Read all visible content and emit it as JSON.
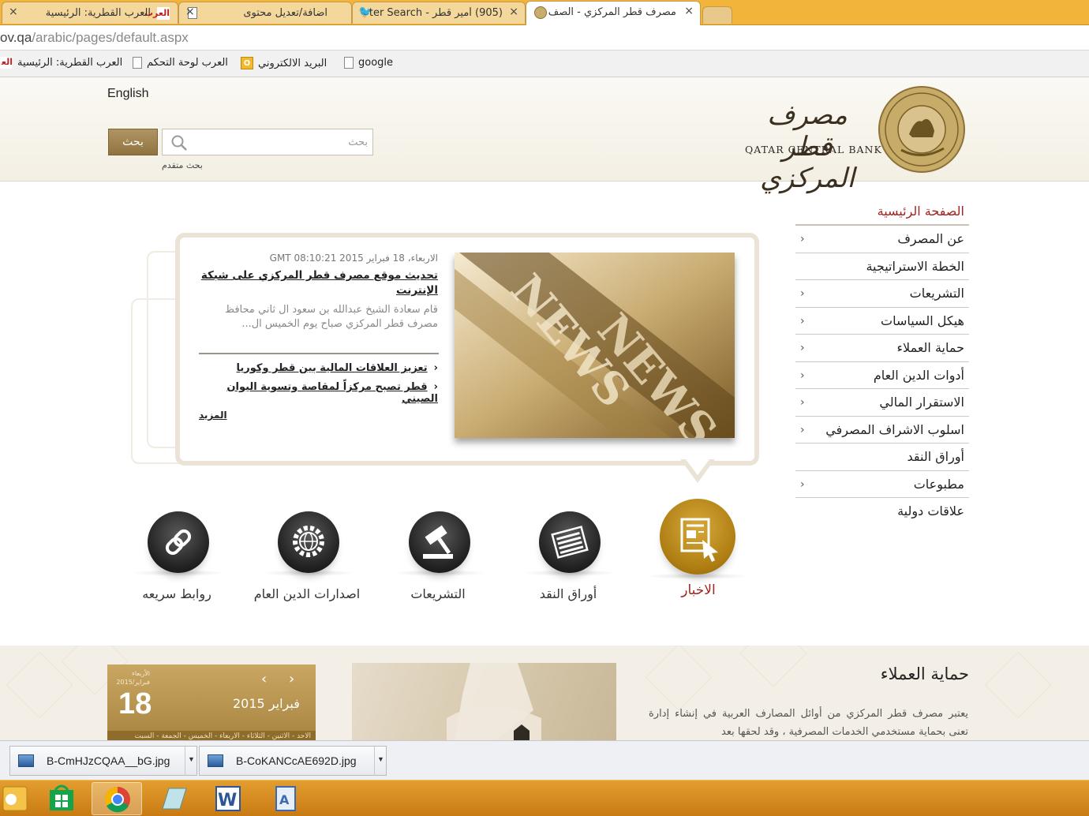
{
  "browser": {
    "tabs": [
      {
        "title": "العرب القطرية: الرئيسية",
        "icon": "alarab-icon",
        "close": "×"
      },
      {
        "title": "اضافة/تعديل محتوى",
        "icon": "page-icon",
        "close": "×"
      },
      {
        "title": "(905) أمير قطر - ter Search",
        "icon": "twitter-bird-icon",
        "close": "×"
      },
      {
        "title": "مصرف قطر المركزي - الصف",
        "icon": "qcb-seal-icon",
        "close": "×"
      }
    ],
    "url_host": "ov.qa",
    "url_path": "/arabic/pages/default.aspx",
    "bookmarks": [
      {
        "label": "العرب القطرية: الرئيسية",
        "icon": "alarab-icon"
      },
      {
        "label": "العرب لوحة التحكم",
        "icon": "page-icon"
      },
      {
        "label": "البريد الالكتروني",
        "icon": "mail-icon"
      },
      {
        "label": "google",
        "icon": "page-icon"
      }
    ]
  },
  "header": {
    "english_link": "English",
    "search_placeholder": "بحث",
    "search_button": "بحث",
    "advanced_search": "بحث متقدم",
    "logo_ar": "مصرف قطر المركزي",
    "logo_en": "QATAR CENTRAL BANK"
  },
  "nav": {
    "home": "الصفحة الرئيسية",
    "items": [
      {
        "label": "عن المصرف",
        "chevron": "‹"
      },
      {
        "label": "الخطة الاستراتيجية",
        "chevron": ""
      },
      {
        "label": "التشريعات",
        "chevron": "‹"
      },
      {
        "label": "هيكل السياسات",
        "chevron": "‹"
      },
      {
        "label": "حماية العملاء",
        "chevron": "‹"
      },
      {
        "label": "أدوات الدين العام",
        "chevron": "‹"
      },
      {
        "label": "الاستقرار المالي",
        "chevron": "‹"
      },
      {
        "label": "اسلوب الاشراف المصرفي",
        "chevron": "‹"
      },
      {
        "label": "أوراق النقد",
        "chevron": ""
      },
      {
        "label": "مطبوعات",
        "chevron": "‹"
      },
      {
        "label": "علاقات دولية",
        "chevron": ""
      }
    ]
  },
  "news": {
    "date": "الاربعاء، 18 فبراير 2015 GMT 08:10:21",
    "title": "تحديث موقع مصرف قطر المركزي على شبكة الإنترنت",
    "excerpt": "قام سعادة الشيخ عبدالله بن سعود ال ثاني محافظ مصرف قطر المركزي صباح يوم الخميس ال...",
    "links": [
      "تعزيز العلاقات المالية بين قطر وكوريا",
      "قطر تصبح مركزاً لمقاصة وتسوية اليوان الصيني"
    ],
    "bullet": "‹",
    "more": "المزيد",
    "image_text": "NEWS"
  },
  "quick_icons": [
    {
      "label": "الاخبار",
      "icon": "news-icon",
      "active": true
    },
    {
      "label": "أوراق النقد",
      "icon": "banknotes-icon",
      "active": false
    },
    {
      "label": "التشريعات",
      "icon": "gavel-icon",
      "active": false
    },
    {
      "label": "اصدارات الدين العام",
      "icon": "globe-gear-icon",
      "active": false
    },
    {
      "label": "روابط سريعه",
      "icon": "link-icon",
      "active": false
    }
  ],
  "calendar": {
    "weekday": "الأربعاء",
    "small_date": "فبراير/2015",
    "day": "18",
    "month_year": "فبراير 2015",
    "prev": "‹",
    "next": "›",
    "strip_text": "الاحد - الاثنين - الثلاثاء - الاربعاء - الخميس - الجمعة - السبت"
  },
  "protection": {
    "title": "حماية العملاء",
    "text": "يعتبر مصرف قطر المركزي من أوائل المصارف العربية في إنشاء إدارة تعنى بحماية مستخدمي الخدمات المصرفية ، وقد لحقها بعد"
  },
  "downloads": [
    {
      "name": "B-CmHJzCQAA__bG.jpg",
      "caret": "▼"
    },
    {
      "name": "B-CoKANCcAE692D.jpg",
      "caret": "▼"
    }
  ],
  "taskbar": {
    "apps": [
      "outlook-icon",
      "store-icon",
      "chrome-icon",
      "notes-icon",
      "word-icon",
      "wordpad-icon"
    ]
  },
  "colors": {
    "accent_red": "#a3241f",
    "gold": "#b07f14",
    "tabbar": "#f2b43a",
    "taskbar": "#d98c22"
  }
}
